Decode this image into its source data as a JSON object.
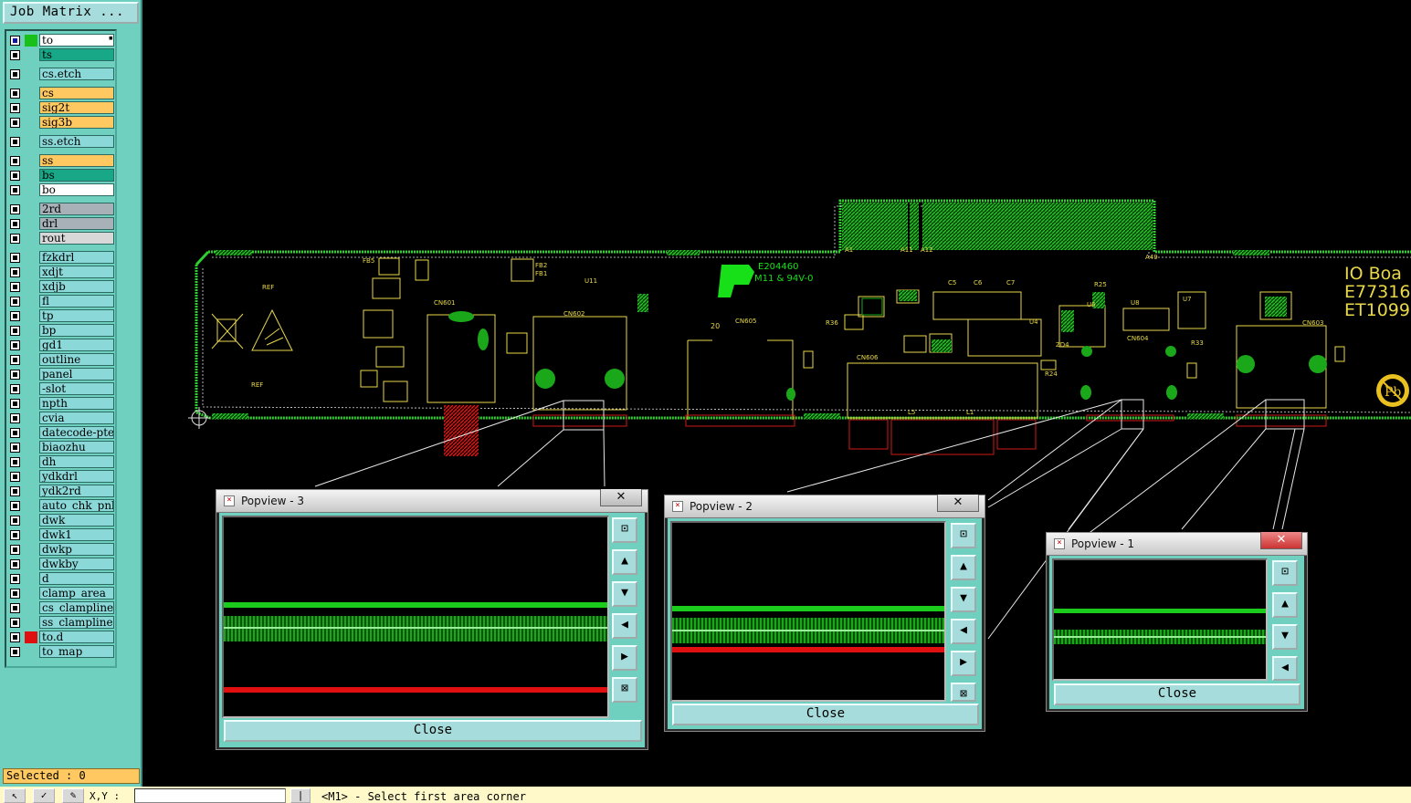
{
  "left_panel": {
    "title_button": "Job Matrix ...",
    "layers": [
      {
        "name": "to",
        "color": "#ffffff",
        "mark": "#18c018",
        "active": true,
        "dropdown": true
      },
      {
        "name": "ts",
        "color": "#18a888"
      },
      {
        "name": "cs.etch",
        "color": "#8ad8d8",
        "gap": true
      },
      {
        "name": "cs",
        "color": "#ffc860",
        "gap": true
      },
      {
        "name": "sig2t",
        "color": "#ffc860"
      },
      {
        "name": "sig3b",
        "color": "#ffc860"
      },
      {
        "name": "ss.etch",
        "color": "#8ad8d8",
        "gap": true
      },
      {
        "name": "ss",
        "color": "#ffc860",
        "gap": true
      },
      {
        "name": "bs",
        "color": "#18a888"
      },
      {
        "name": "bo",
        "color": "#ffffff"
      },
      {
        "name": "2rd",
        "color": "#a8b0b8",
        "gap": true
      },
      {
        "name": "drl",
        "color": "#a8b0b8"
      },
      {
        "name": "rout",
        "color": "#d8d8d8"
      },
      {
        "name": "fzkdrl",
        "color": "#8ad8d8",
        "gap": true
      },
      {
        "name": "xdjt",
        "color": "#8ad8d8"
      },
      {
        "name": "xdjb",
        "color": "#8ad8d8"
      },
      {
        "name": "fl",
        "color": "#8ad8d8"
      },
      {
        "name": "tp",
        "color": "#8ad8d8"
      },
      {
        "name": "bp",
        "color": "#8ad8d8"
      },
      {
        "name": "gd1",
        "color": "#8ad8d8"
      },
      {
        "name": "outline",
        "color": "#8ad8d8"
      },
      {
        "name": "panel",
        "color": "#8ad8d8"
      },
      {
        "name": "-slot",
        "color": "#8ad8d8"
      },
      {
        "name": "npth",
        "color": "#8ad8d8"
      },
      {
        "name": "cvia",
        "color": "#8ad8d8"
      },
      {
        "name": "datecode-pte",
        "color": "#8ad8d8"
      },
      {
        "name": "biaozhu",
        "color": "#8ad8d8"
      },
      {
        "name": "dh",
        "color": "#8ad8d8"
      },
      {
        "name": "ydkdrl",
        "color": "#8ad8d8"
      },
      {
        "name": "ydk2rd",
        "color": "#8ad8d8"
      },
      {
        "name": "auto_chk_pnl",
        "color": "#8ad8d8"
      },
      {
        "name": "dwk",
        "color": "#8ad8d8"
      },
      {
        "name": "dwk1",
        "color": "#8ad8d8"
      },
      {
        "name": "dwkp",
        "color": "#8ad8d8"
      },
      {
        "name": "dwkby",
        "color": "#8ad8d8"
      },
      {
        "name": "d",
        "color": "#8ad8d8"
      },
      {
        "name": "clamp_area",
        "color": "#8ad8d8"
      },
      {
        "name": "cs_clampline",
        "color": "#8ad8d8"
      },
      {
        "name": "ss_clampline",
        "color": "#8ad8d8"
      },
      {
        "name": "to.d",
        "color": "#8ad8d8",
        "mark": "#e01010"
      },
      {
        "name": "to_map",
        "color": "#8ad8d8"
      }
    ],
    "selected": "Selected : 0"
  },
  "bottom_bar": {
    "xy_label": "X,Y :",
    "xy_value": "",
    "status": "<M1> - Select first area corner"
  },
  "board": {
    "silk_labels": [
      "E204460",
      "M11 & 94V-0",
      "IO Boa",
      "E77316",
      "ET1099",
      "REF",
      "REF",
      "CN601",
      "CN602",
      "CN605",
      "CN606",
      "CN603",
      "CN604",
      "FB5",
      "FB2",
      "FB1",
      "U11",
      "U8",
      "U7",
      "U4",
      "U6",
      "C5",
      "C6",
      "C7",
      "ZD4",
      "R24",
      "R33",
      "R25",
      "R36",
      "L5",
      "L1",
      "A1",
      "A11",
      "A12",
      "A49",
      "20"
    ],
    "colors": {
      "silk": "#e8d84a",
      "copper": "#1aa81a",
      "mask": "#d01818",
      "outline": "#e0e0e0",
      "logo": "#18e018"
    }
  },
  "popviews": [
    {
      "id": "3",
      "title": "Popview - 3",
      "close_label": "Close",
      "close_x": "✕"
    },
    {
      "id": "2",
      "title": "Popview - 2",
      "close_label": "Close",
      "close_x": "✕"
    },
    {
      "id": "1",
      "title": "Popview - 1",
      "close_label": "Close",
      "close_x": "✕"
    }
  ],
  "icons": [
    "zoom-fit-icon",
    "pan-up-icon",
    "pan-down-icon",
    "pan-left-icon",
    "pan-right-icon",
    "zoom-box-icon"
  ]
}
